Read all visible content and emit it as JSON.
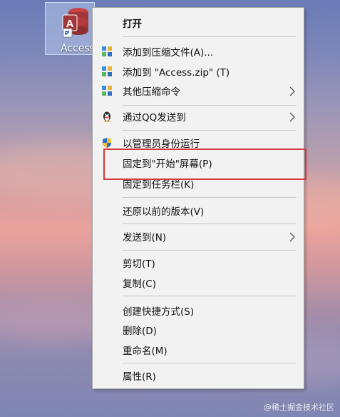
{
  "desktop": {
    "icon_label": "Access",
    "icon_name": "access-shortcut-icon",
    "watermark": "@稀土掘金技术社区"
  },
  "context_menu": {
    "items": [
      {
        "label": "打开",
        "bold": true
      },
      {
        "label": "添加到压缩文件(A)...",
        "icon": "archive-icon"
      },
      {
        "label": "添加到 \"Access.zip\" (T)",
        "icon": "archive-icon"
      },
      {
        "label": "其他压缩命令",
        "icon": "archive-icon",
        "submenu": true
      },
      {
        "label": "通过QQ发送到",
        "icon": "qq-penguin-icon",
        "submenu": true
      },
      {
        "label": "以管理员身份运行",
        "icon": "uac-shield-icon"
      },
      {
        "label": "固定到\"开始\"屏幕(P)"
      },
      {
        "label": "固定到任务栏(K)"
      },
      {
        "label": "还原以前的版本(V)"
      },
      {
        "label": "发送到(N)",
        "submenu": true
      },
      {
        "label": "剪切(T)"
      },
      {
        "label": "复制(C)"
      },
      {
        "label": "创建快捷方式(S)"
      },
      {
        "label": "删除(D)"
      },
      {
        "label": "重命名(M)"
      },
      {
        "label": "属性(R)"
      }
    ]
  },
  "colors": {
    "menu_background": "#f2f2f2",
    "highlight_border": "#d33a3a",
    "access_red": "#a4373a"
  }
}
